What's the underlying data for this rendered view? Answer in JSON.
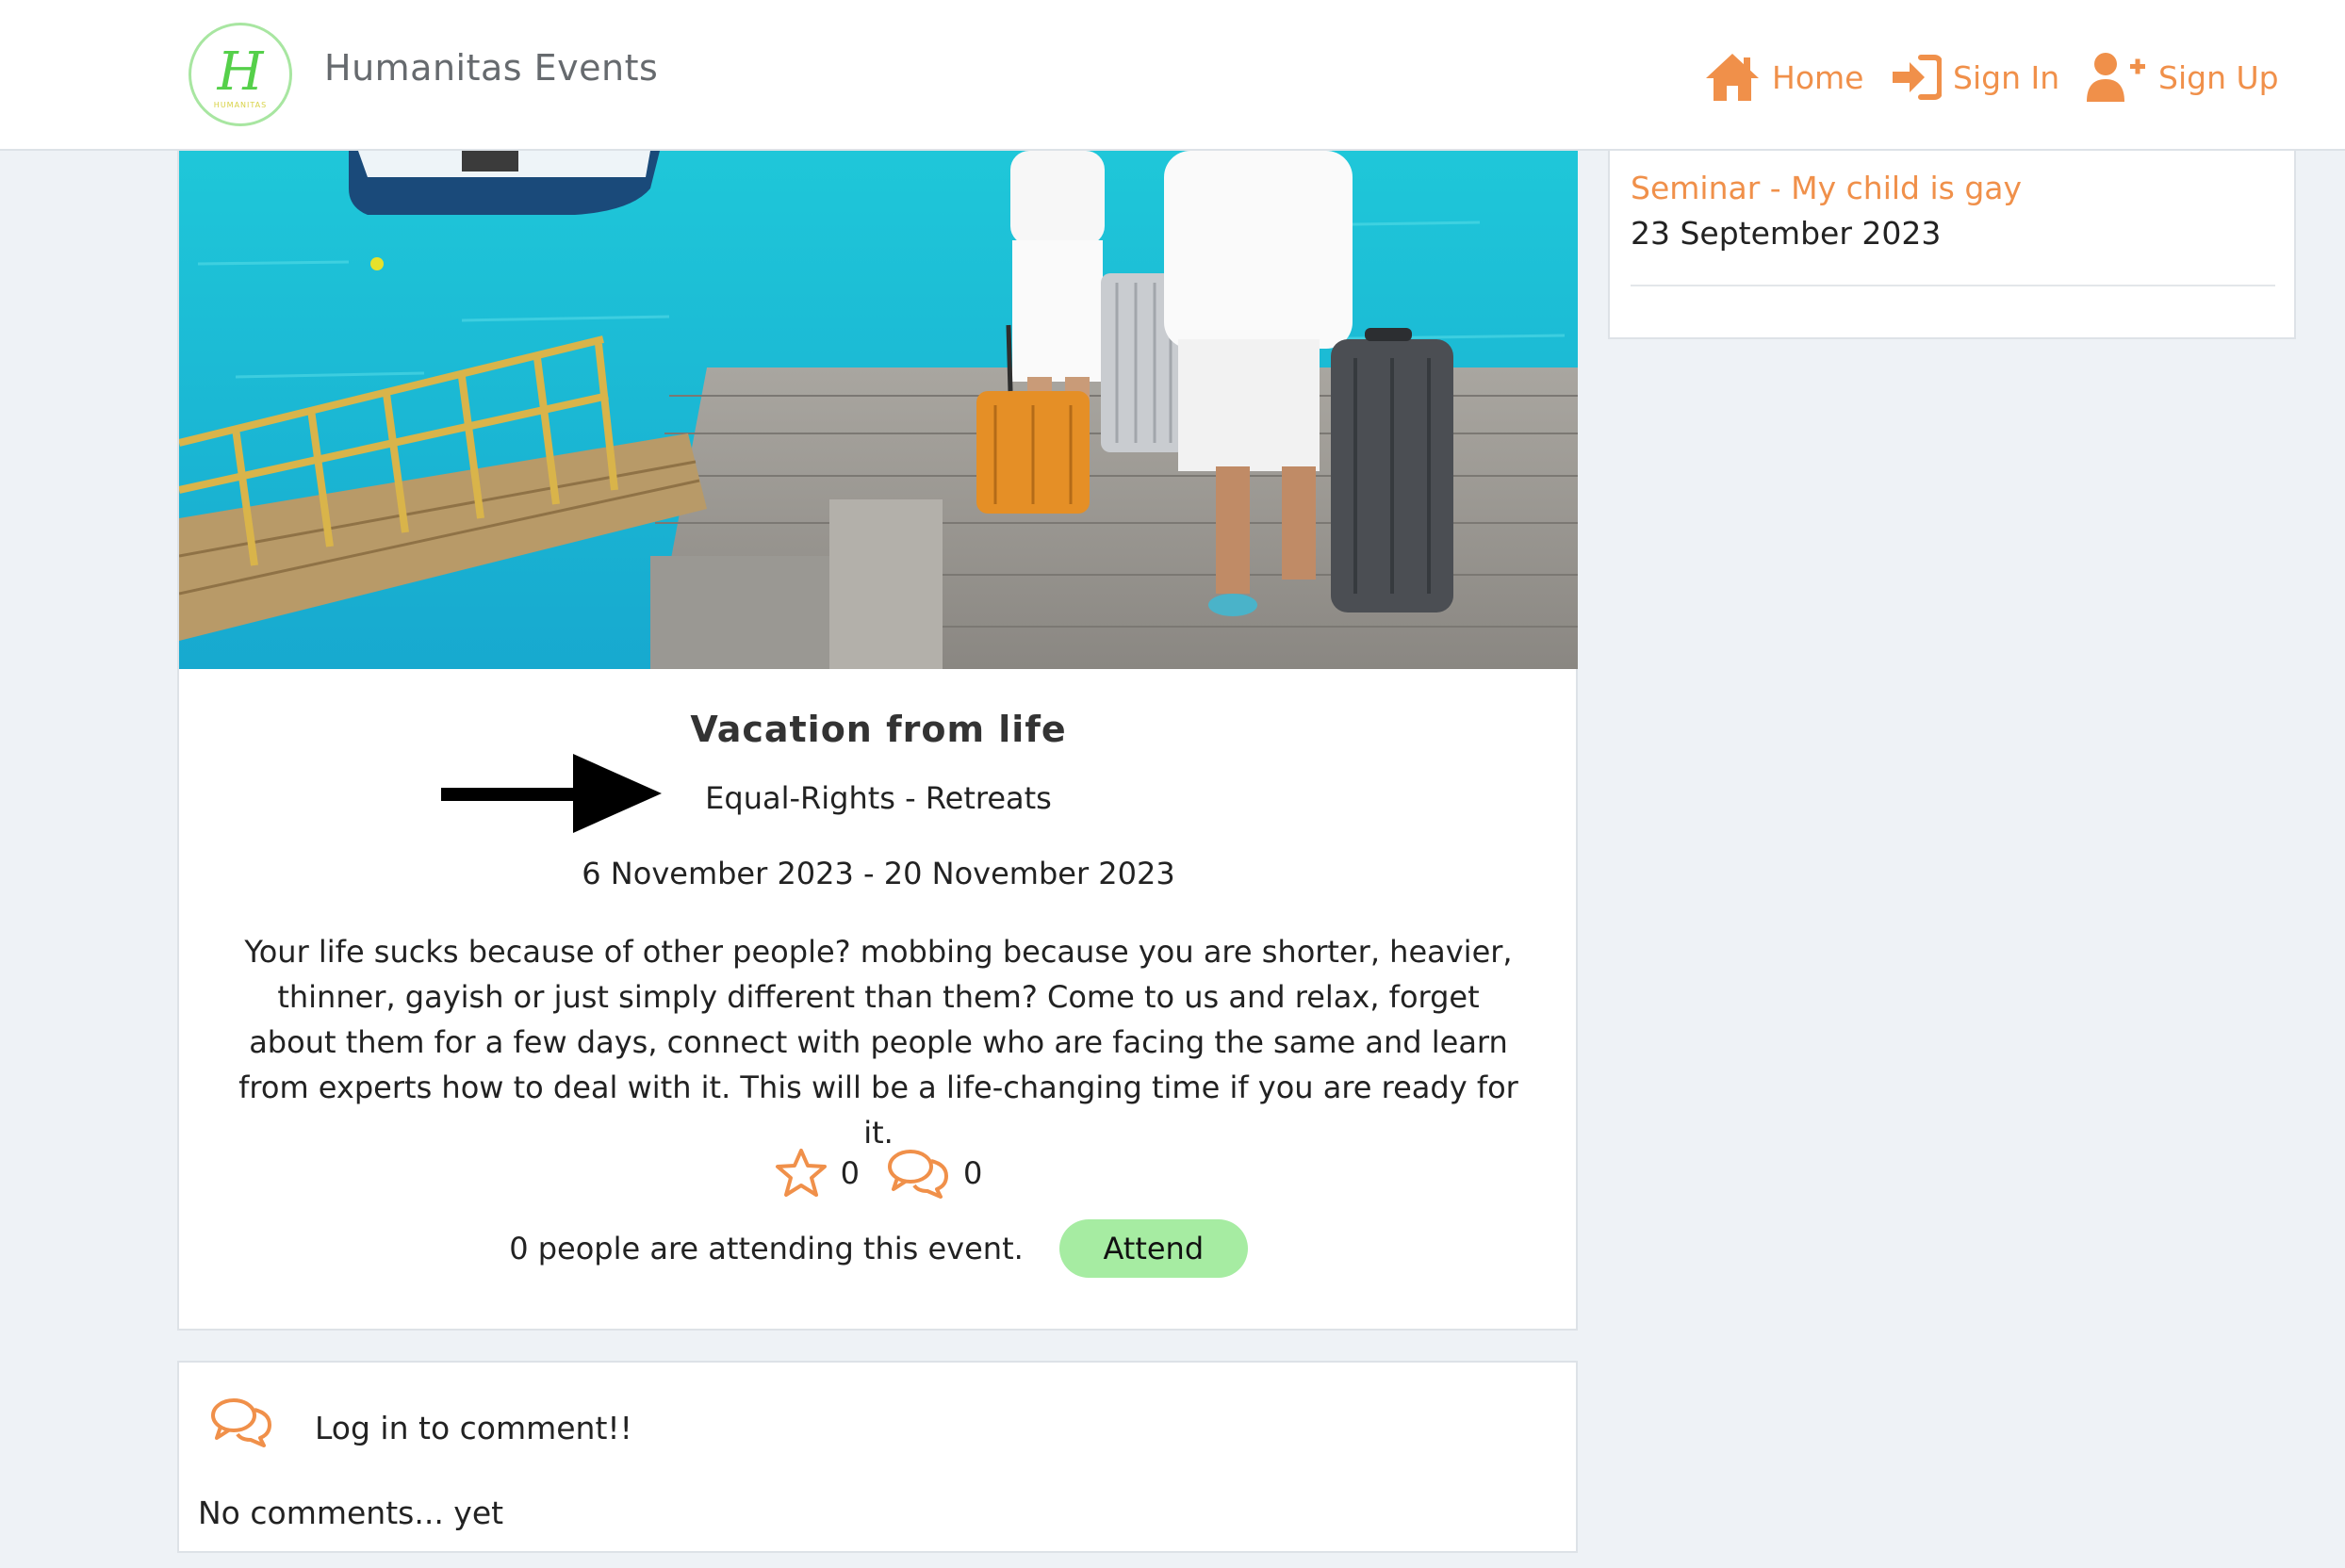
{
  "brand": {
    "name": "Humanitas Events",
    "logo_letter": "H",
    "logo_word": "HUMANITAS",
    "logo_border_color": "#a8e6a1"
  },
  "nav": {
    "home": "Home",
    "sign_in": "Sign In",
    "sign_up": "Sign Up",
    "accent_color": "#f0904a"
  },
  "event": {
    "title": "Vacation from life",
    "categories": "Equal-Rights - Retreats",
    "dates": "6 November 2023 - 20 November 2023",
    "description": "Your life sucks because of other people? mobbing because you are shorter, heavier, thinner, gayish or just simply different than them? Come to us and relax, forget about them for a few days, connect with people who are facing the same and learn from experts how to deal with it. This will be a life-changing time if you are ready for it.",
    "favorites_count": "0",
    "comments_count": "0",
    "attending_text": "0 people are attending this event.",
    "attend_button": "Attend",
    "attend_button_color": "#a6eca2"
  },
  "comments": {
    "login_prompt": "Log in to comment!!",
    "empty_text": "No comments... yet"
  },
  "sidebar": {
    "events": [
      {
        "title": "Seminar - My child is gay",
        "date": "23 September 2023"
      }
    ]
  },
  "colors": {
    "page_bg": "#eef2f6",
    "card_bg": "#ffffff"
  }
}
